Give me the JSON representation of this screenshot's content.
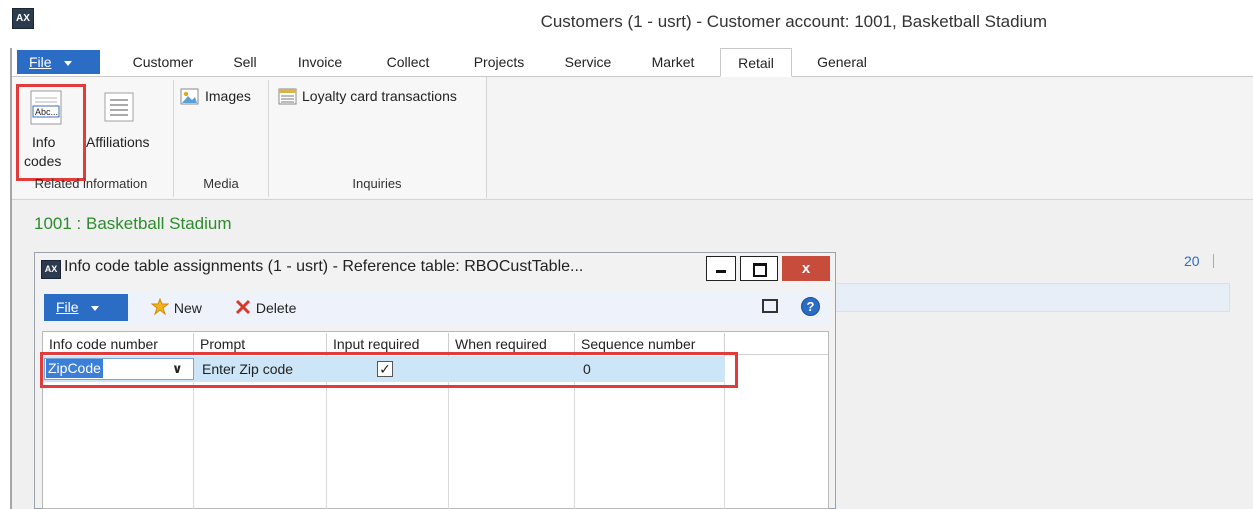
{
  "window": {
    "title": "Customers (1 - usrt) - Customer account: 1001, Basketball Stadium"
  },
  "ribbon": {
    "file_label": "File",
    "tabs": [
      "Customer",
      "Sell",
      "Invoice",
      "Collect",
      "Projects",
      "Service",
      "Market",
      "Retail",
      "General"
    ],
    "active_tab": "Retail",
    "groups": {
      "related_information": {
        "label": "Related information",
        "info_codes_line1": "Info",
        "info_codes_line2": "codes",
        "affiliations": "Affiliations"
      },
      "media": {
        "label": "Media",
        "images": "Images"
      },
      "inquiries": {
        "label": "Inquiries",
        "loyalty": "Loyalty card transactions"
      }
    }
  },
  "record": {
    "title": "1001 : Basketball Stadium",
    "side_number": "20"
  },
  "dialog": {
    "title": "Info code table assignments (1 - usrt) - Reference table: RBOCustTable...",
    "file_label": "File",
    "new_label": "New",
    "delete_label": "Delete",
    "columns": [
      "Info code number",
      "Prompt",
      "Input required",
      "When required",
      "Sequence number"
    ],
    "rows": [
      {
        "info_code_number": "ZipCode",
        "prompt": "Enter Zip code",
        "input_required": true,
        "when_required": "",
        "sequence_number": "0"
      }
    ]
  },
  "colors": {
    "accent": "#2b6cc4",
    "highlight": "#e23b3b",
    "record_title": "#2e8b2e",
    "selected_row": "#cde6f7"
  }
}
